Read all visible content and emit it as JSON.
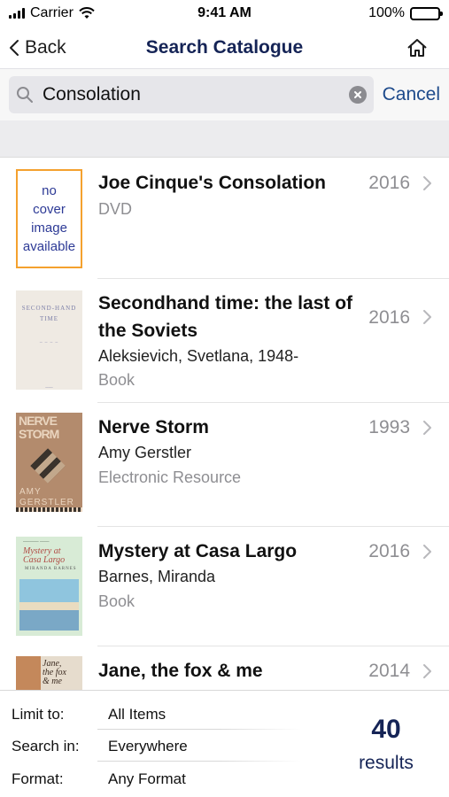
{
  "status_bar": {
    "carrier": "Carrier",
    "time": "9:41 AM",
    "battery": "100%",
    "battery_level": 1.0
  },
  "nav": {
    "back_label": "Back",
    "title": "Search Catalogue",
    "home_icon": "home-icon"
  },
  "search": {
    "value": "Consolation",
    "cancel_label": "Cancel",
    "search_icon": "search-icon",
    "clear_icon": "clear-icon"
  },
  "results": [
    {
      "title": "Joe Cinque's Consolation",
      "author": "",
      "format": "DVD",
      "year": "2016",
      "cover": {
        "line1": "no",
        "line2": "cover",
        "line3": "image",
        "line4": "available"
      }
    },
    {
      "title": "Secondhand time: the last of the Soviets",
      "author": "Aleksievich, Svetlana, 1948-",
      "format": "Book",
      "year": "2016",
      "cover": {
        "line1": "SECOND-HAND",
        "line2": "TIME"
      }
    },
    {
      "title": "Nerve Storm",
      "author": "Amy Gerstler",
      "format": "Electronic Resource",
      "year": "1993",
      "cover": {
        "line1": "NERVE",
        "line2": "STORM",
        "line3": "AMY",
        "line4": "GERSTLER"
      }
    },
    {
      "title": "Mystery at Casa Largo",
      "author": "Barnes, Miranda",
      "format": "Book",
      "year": "2016",
      "cover": {
        "line1": "Mystery at",
        "line2": "Casa Largo",
        "line3": "MIRANDA BARNES"
      }
    },
    {
      "title": "Jane, the fox & me",
      "author": "",
      "format": "",
      "year": "2014",
      "cover": {
        "line1": "Jane,",
        "line2": "the fox",
        "line3": "& me"
      }
    }
  ],
  "filters": [
    {
      "key": "Limit to:",
      "value": "All Items"
    },
    {
      "key": "Search in:",
      "value": "Everywhere"
    },
    {
      "key": "Format:",
      "value": "Any Format"
    }
  ],
  "result_count": "40",
  "result_count_label": "results",
  "colors": {
    "nav_title": "#152456",
    "accent": "#1d4a8b",
    "secondary_text": "#8e8e92"
  }
}
